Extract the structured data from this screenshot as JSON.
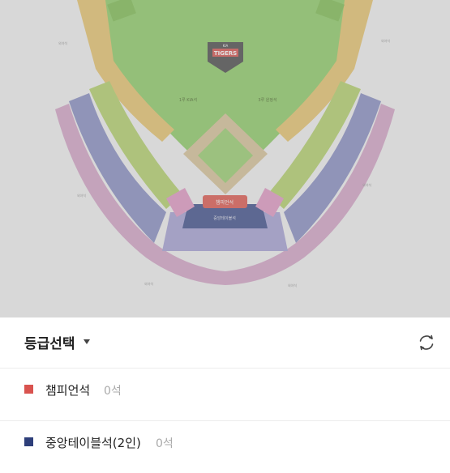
{
  "map": {
    "team_logo": "TIGERS",
    "logo_badge": "KIA",
    "dugout_left": "1루 KIA석",
    "dugout_right": "3루 원정석",
    "champion_label": "챔피언석",
    "table_label": "중앙테이블석",
    "outer_labels": [
      "외야석",
      "외야석",
      "외야석",
      "외야석",
      "외야석",
      "외야석"
    ]
  },
  "header": {
    "title": "등급선택",
    "caret_icon": "caret-down-icon",
    "refresh_icon": "refresh-icon"
  },
  "grades": [
    {
      "name": "챔피언석",
      "count": "0석",
      "color": "#d9534f"
    },
    {
      "name": "중앙테이블석(2인)",
      "count": "0석",
      "color": "#2e3f7a"
    }
  ]
}
